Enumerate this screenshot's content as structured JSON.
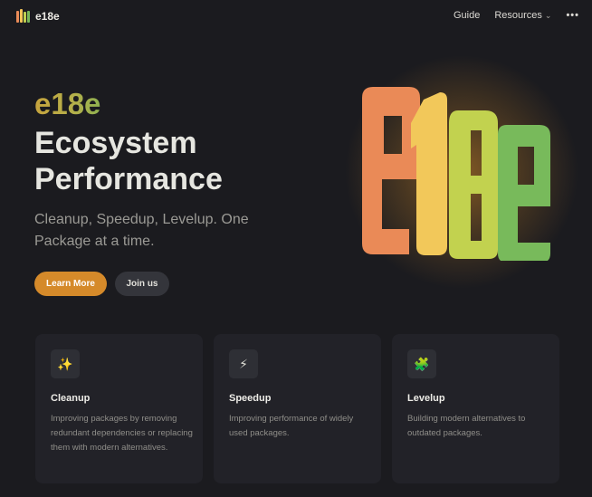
{
  "nav": {
    "brand_name": "e18e",
    "links": [
      {
        "label": "Guide"
      },
      {
        "label": "Resources"
      }
    ],
    "more_label": "•••",
    "brand_colors": [
      "#e98b58",
      "#f3c658",
      "#bfd04f",
      "#78b95a"
    ]
  },
  "hero": {
    "name": "e18e",
    "title": "Ecosystem Performance",
    "tagline": "Cleanup, Speedup, Levelup. One Package at a time.",
    "actions": {
      "primary": "Learn More",
      "secondary": "Join us"
    },
    "logo_text": "e18e",
    "accent_color": "#d58a2a"
  },
  "features": [
    {
      "icon": "sparkles-icon",
      "icon_glyph": "✨",
      "title": "Cleanup",
      "details": "Improving packages by removing redundant dependencies or replacing them with modern alternatives."
    },
    {
      "icon": "lightning-icon",
      "icon_glyph": "⚡",
      "title": "Speedup",
      "details": "Improving performance of widely used packages."
    },
    {
      "icon": "puzzle-icon",
      "icon_glyph": "🧩",
      "title": "Levelup",
      "details": "Building modern alternatives to outdated packages."
    }
  ]
}
